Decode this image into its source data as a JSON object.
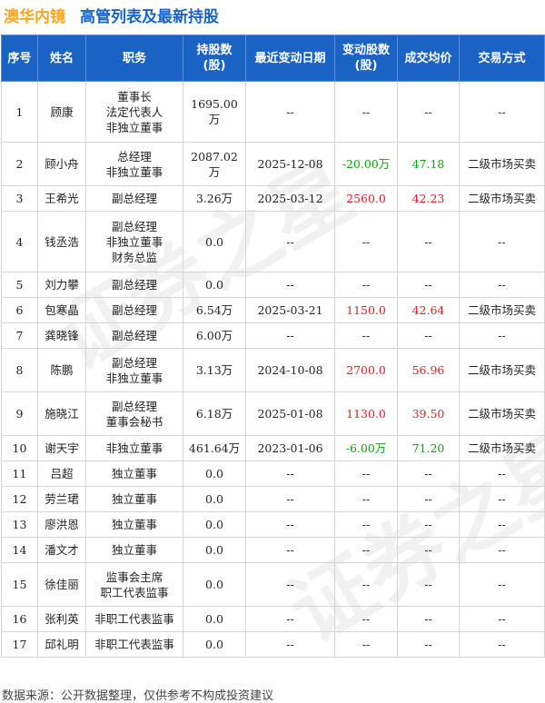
{
  "title": {
    "company": "澳华内镜",
    "subtitle": "高管列表及最新持股"
  },
  "watermark": "证券之星",
  "table": {
    "headers": [
      "序号",
      "姓名",
      "职务",
      "持股数\n(股)",
      "最近变动日期",
      "变动股数\n(股)",
      "成交均价",
      "交易方式"
    ],
    "rows": [
      {
        "no": "1",
        "name": "顾康",
        "roles": [
          "董事长",
          "法定代表人",
          "非独立董事"
        ],
        "shares": "1695.00万",
        "date": "--",
        "change": "--",
        "price": "--",
        "method": "--",
        "change_sign": "",
        "price_sign": ""
      },
      {
        "no": "2",
        "name": "顾小舟",
        "roles": [
          "总经理",
          "非独立董事"
        ],
        "shares": "2087.02万",
        "date": "2025-12-08",
        "change": "-20.00万",
        "price": "47.18",
        "method": "二级市场买卖",
        "change_sign": "neg",
        "price_sign": "neg"
      },
      {
        "no": "3",
        "name": "王希光",
        "roles": [
          "副总经理"
        ],
        "shares": "3.26万",
        "date": "2025-03-12",
        "change": "2560.0",
        "price": "42.23",
        "method": "二级市场买卖",
        "change_sign": "pos",
        "price_sign": "pos"
      },
      {
        "no": "4",
        "name": "钱丞浩",
        "roles": [
          "副总经理",
          "非独立董事",
          "财务总监"
        ],
        "shares": "0.0",
        "date": "--",
        "change": "--",
        "price": "--",
        "method": "--",
        "change_sign": "",
        "price_sign": ""
      },
      {
        "no": "5",
        "name": "刘力攀",
        "roles": [
          "副总经理"
        ],
        "shares": "0.0",
        "date": "--",
        "change": "--",
        "price": "--",
        "method": "--",
        "change_sign": "",
        "price_sign": ""
      },
      {
        "no": "6",
        "name": "包寒晶",
        "roles": [
          "副总经理"
        ],
        "shares": "6.54万",
        "date": "2025-03-21",
        "change": "1150.0",
        "price": "42.64",
        "method": "二级市场买卖",
        "change_sign": "pos",
        "price_sign": "pos"
      },
      {
        "no": "7",
        "name": "龚晓锋",
        "roles": [
          "副总经理"
        ],
        "shares": "6.00万",
        "date": "--",
        "change": "--",
        "price": "--",
        "method": "--",
        "change_sign": "",
        "price_sign": ""
      },
      {
        "no": "8",
        "name": "陈鹏",
        "roles": [
          "副总经理",
          "非独立董事"
        ],
        "shares": "3.13万",
        "date": "2024-10-08",
        "change": "2700.0",
        "price": "56.96",
        "method": "二级市场买卖",
        "change_sign": "pos",
        "price_sign": "pos"
      },
      {
        "no": "9",
        "name": "施晓江",
        "roles": [
          "副总经理",
          "董事会秘书"
        ],
        "shares": "6.18万",
        "date": "2025-01-08",
        "change": "1130.0",
        "price": "39.50",
        "method": "二级市场买卖",
        "change_sign": "pos",
        "price_sign": "pos"
      },
      {
        "no": "10",
        "name": "谢天宇",
        "roles": [
          "非独立董事"
        ],
        "shares": "461.64万",
        "date": "2023-01-06",
        "change": "-6.00万",
        "price": "71.20",
        "method": "二级市场买卖",
        "change_sign": "neg",
        "price_sign": "neg"
      },
      {
        "no": "11",
        "name": "吕超",
        "roles": [
          "独立董事"
        ],
        "shares": "0.0",
        "date": "--",
        "change": "--",
        "price": "--",
        "method": "--",
        "change_sign": "",
        "price_sign": ""
      },
      {
        "no": "12",
        "name": "劳兰珺",
        "roles": [
          "独立董事"
        ],
        "shares": "0.0",
        "date": "--",
        "change": "--",
        "price": "--",
        "method": "--",
        "change_sign": "",
        "price_sign": ""
      },
      {
        "no": "13",
        "name": "廖洪恩",
        "roles": [
          "独立董事"
        ],
        "shares": "0.0",
        "date": "--",
        "change": "--",
        "price": "--",
        "method": "--",
        "change_sign": "",
        "price_sign": ""
      },
      {
        "no": "14",
        "name": "潘文才",
        "roles": [
          "独立董事"
        ],
        "shares": "0.0",
        "date": "--",
        "change": "--",
        "price": "--",
        "method": "--",
        "change_sign": "",
        "price_sign": ""
      },
      {
        "no": "15",
        "name": "徐佳丽",
        "roles": [
          "监事会主席",
          "职工代表监事"
        ],
        "shares": "0.0",
        "date": "--",
        "change": "--",
        "price": "--",
        "method": "--",
        "change_sign": "",
        "price_sign": ""
      },
      {
        "no": "16",
        "name": "张利英",
        "roles": [
          "非职工代表监事"
        ],
        "shares": "0.0",
        "date": "--",
        "change": "--",
        "price": "--",
        "method": "--",
        "change_sign": "",
        "price_sign": ""
      },
      {
        "no": "17",
        "name": "邱礼明",
        "roles": [
          "非职工代表监事"
        ],
        "shares": "0.0",
        "date": "--",
        "change": "--",
        "price": "--",
        "method": "--",
        "change_sign": "",
        "price_sign": ""
      }
    ]
  },
  "footer": "数据来源：公开数据整理，仅供参考不构成投资建议",
  "colors": {
    "header_bg": "#1a63c4",
    "title_company": "#f5a623",
    "title_sub": "#1a63c4",
    "positive": "#e02020",
    "negative": "#12a012"
  }
}
